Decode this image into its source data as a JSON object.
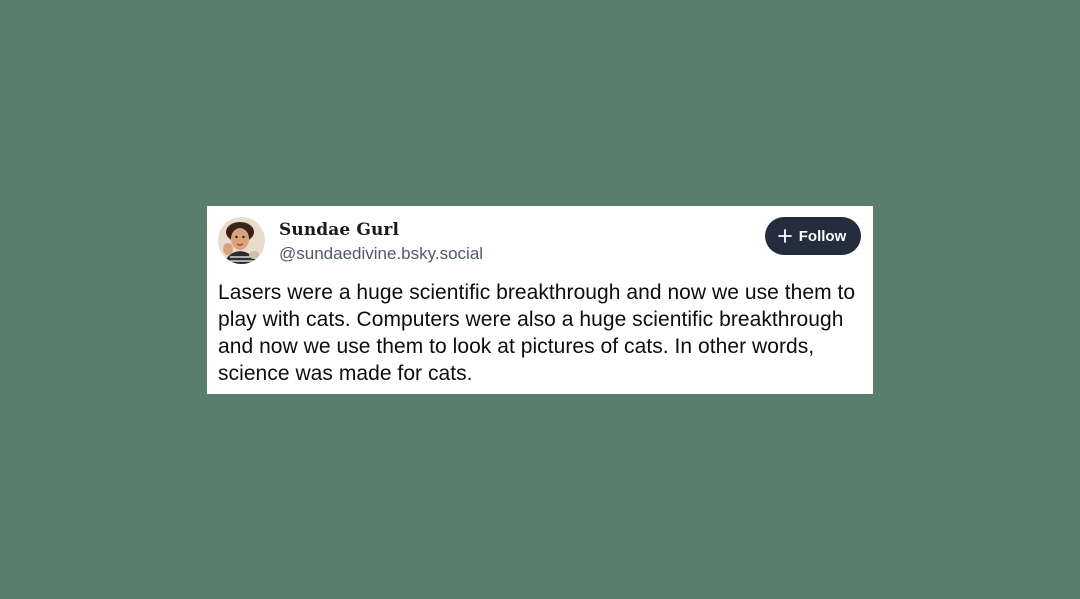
{
  "post": {
    "author": {
      "display_name": "Sundae Gurl",
      "handle": "@sundaedivine.bsky.social",
      "avatar_icon": "profile-photo"
    },
    "follow_button": {
      "label": "Follow",
      "icon": "plus-icon"
    },
    "text": "Lasers were a huge scientific breakthrough and now we use them to play with cats. Computers were also a huge scientific breakthrough and now we use them to look at pictures of cats. In other words, science was made for cats."
  },
  "colors": {
    "background": "#5b7f6f",
    "card": "#ffffff",
    "follow_button": "#232d3d",
    "handle_text": "#50596b"
  }
}
